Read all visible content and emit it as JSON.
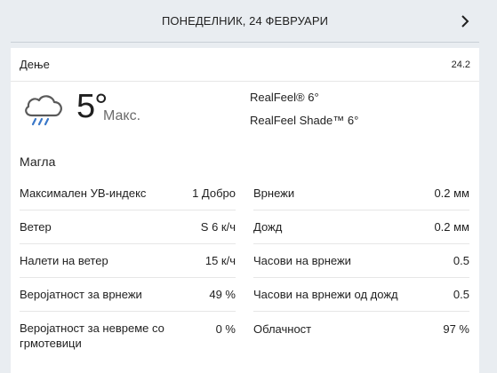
{
  "header": {
    "date": "ПОНЕДЕЛНИК, 24 ФЕВРУАРИ"
  },
  "card": {
    "period": "Дење",
    "short_date": "24.2",
    "temperature": "5°",
    "temp_label": "Макс.",
    "realfeel": "RealFeel® 6°",
    "realfeel_shade": "RealFeel Shade™ 6°",
    "phrase": "Магла",
    "icon": "rain-cloud-icon"
  },
  "details_left": [
    {
      "name": "Максимален УВ-индекс",
      "value": "1 Добро"
    },
    {
      "name": "Ветер",
      "value": "S 6 к/ч"
    },
    {
      "name": "Налети на ветер",
      "value": "15 к/ч"
    },
    {
      "name": "Веројатност за врнежи",
      "value": "49 %"
    },
    {
      "name": "Веројатност за невреме со грмотевици",
      "value": "0 %"
    }
  ],
  "details_right": [
    {
      "name": "Врнежи",
      "value": "0.2 мм"
    },
    {
      "name": "Дожд",
      "value": "0.2 мм"
    },
    {
      "name": "Часови на врнежи",
      "value": "0.5"
    },
    {
      "name": "Часови на врнежи од дожд",
      "value": "0.5"
    },
    {
      "name": "Облачност",
      "value": "97 %"
    }
  ],
  "colors": {
    "background": "#e9edf1",
    "card": "#ffffff",
    "icon": "#5a5a5a",
    "rain": "#3a78c9"
  }
}
